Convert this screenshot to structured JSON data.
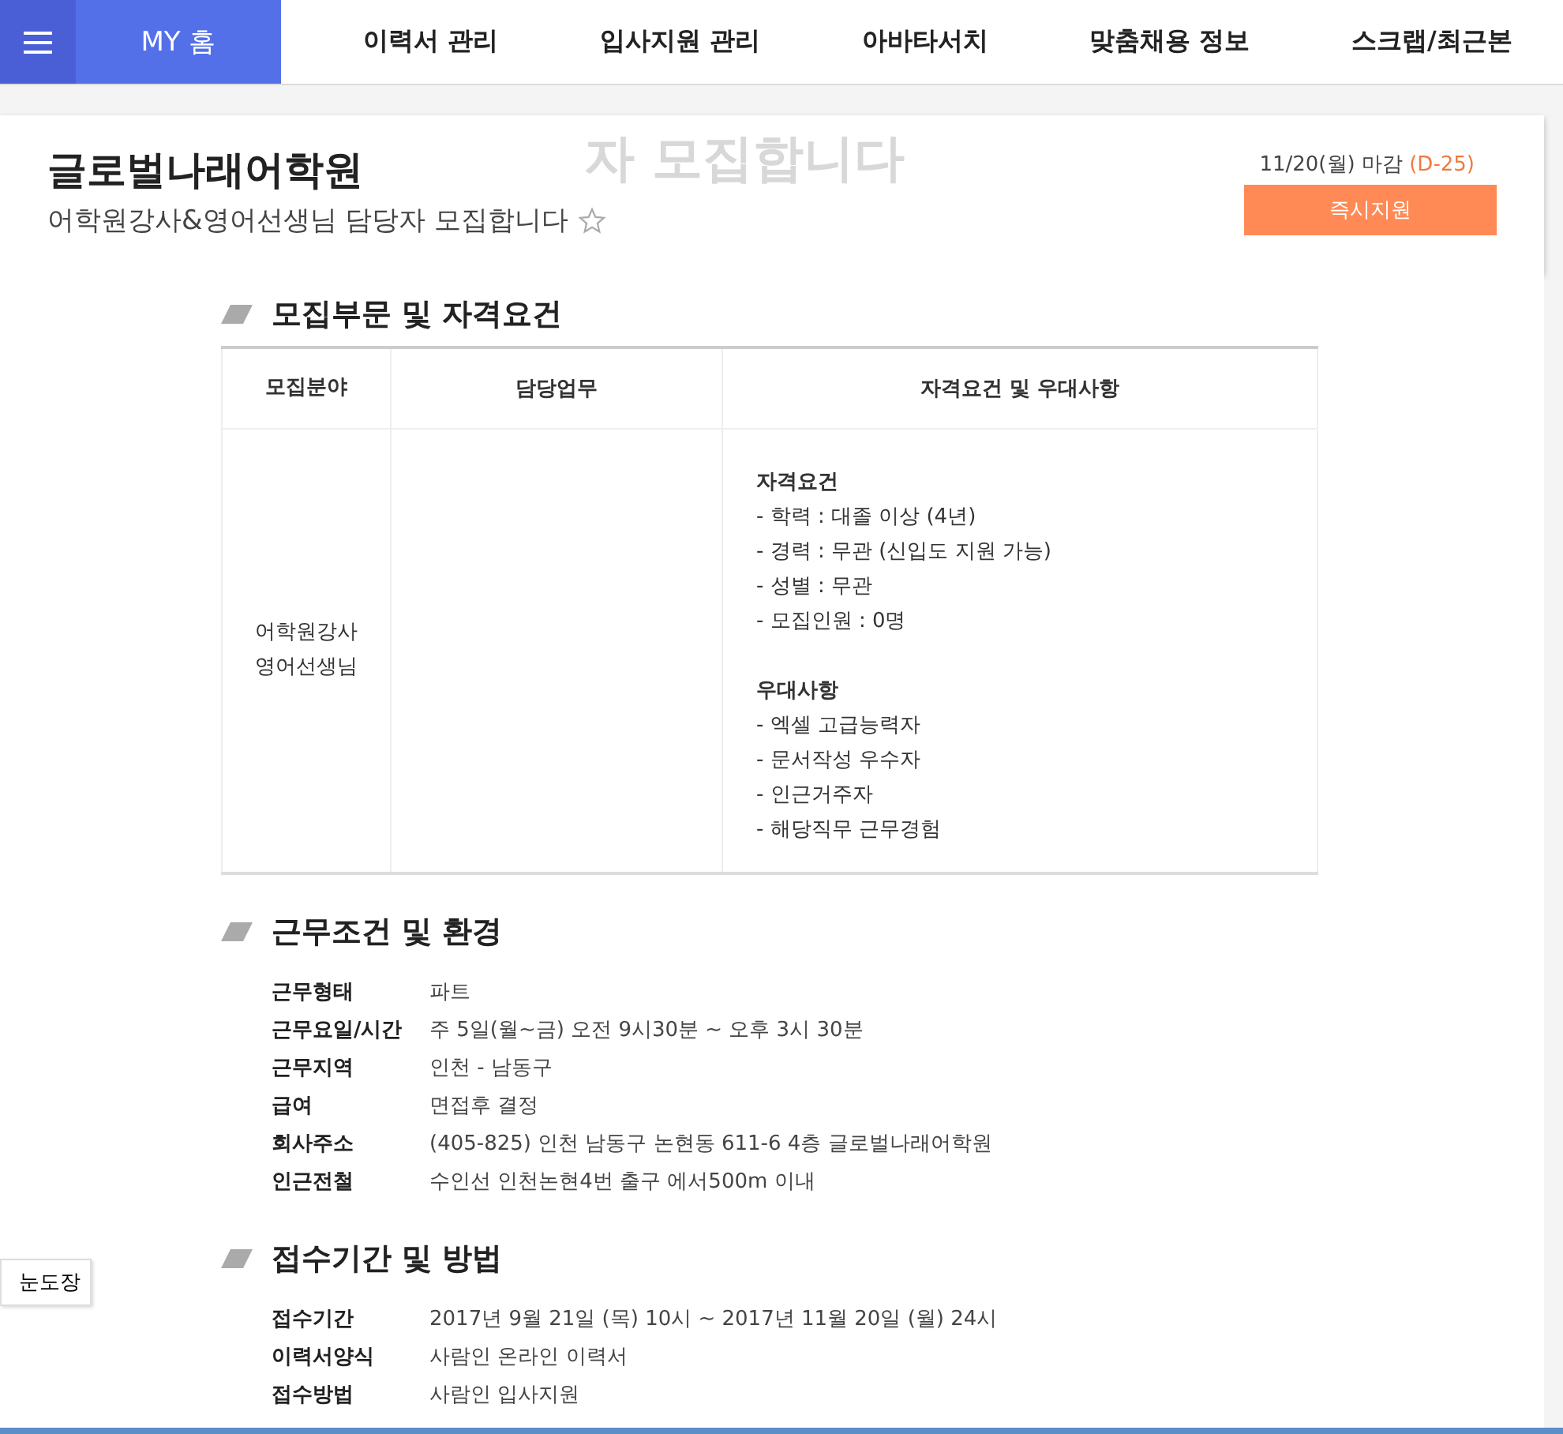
{
  "nav": {
    "home": "MY 홈",
    "items": [
      "이력서 관리",
      "입사지원 관리",
      "아바타서치",
      "맞춤채용 정보",
      "스크랩/최근본"
    ]
  },
  "ghost_title": "자 모집합니다",
  "job": {
    "company": "글로벌나래어학원",
    "title": "어학원강사&영어선생님 담당자 모집합니다",
    "starred": false,
    "deadline": "11/20(월) 마감",
    "dday": "(D-25)",
    "apply": "즉시지원"
  },
  "side_button": "눈도장",
  "section1": {
    "heading": "모집부문 및 자격요건",
    "columns": [
      "모집분야",
      "담당업무",
      "자격요건 및 우대사항"
    ],
    "field": [
      "어학원강사",
      "영어선생님"
    ],
    "groups": [
      {
        "title": "자격요건",
        "lines": [
          "- 학력 : 대졸 이상 (4년)",
          "- 경력 : 무관 (신입도 지원 가능)",
          "- 성별 : 무관",
          "- 모집인원 : 0명"
        ]
      },
      {
        "title": "우대사항",
        "lines": [
          "- 엑셀 고급능력자",
          "- 문서작성 우수자",
          "- 인근거주자",
          "- 해당직무 근무경험"
        ]
      }
    ]
  },
  "sections": [
    {
      "heading": "근무조건 및 환경",
      "rows": [
        {
          "label": "근무형태",
          "value": "파트"
        },
        {
          "label": "근무요일/시간",
          "value": "주 5일(월~금) 오전 9시30분 ~ 오후 3시 30분"
        },
        {
          "label": "근무지역",
          "value": "인천 - 남동구"
        },
        {
          "label": "급여",
          "value": "면접후 결정"
        },
        {
          "label": "회사주소",
          "value": "(405-825) 인천 남동구 논현동 611-6 4층 글로벌나래어학원"
        },
        {
          "label": "인근전철",
          "value": "수인선 인천논현4번 출구 에서500m 이내"
        }
      ]
    },
    {
      "heading": "접수기간 및 방법",
      "rows": [
        {
          "label": "접수기간",
          "value": "2017년 9월 21일 (목) 10시 ~ 2017년 11월 20일 (월) 24시"
        },
        {
          "label": "이력서양식",
          "value": "사람인 온라인 이력서"
        },
        {
          "label": "접수방법",
          "value": "사람인 입사지원"
        }
      ]
    }
  ]
}
